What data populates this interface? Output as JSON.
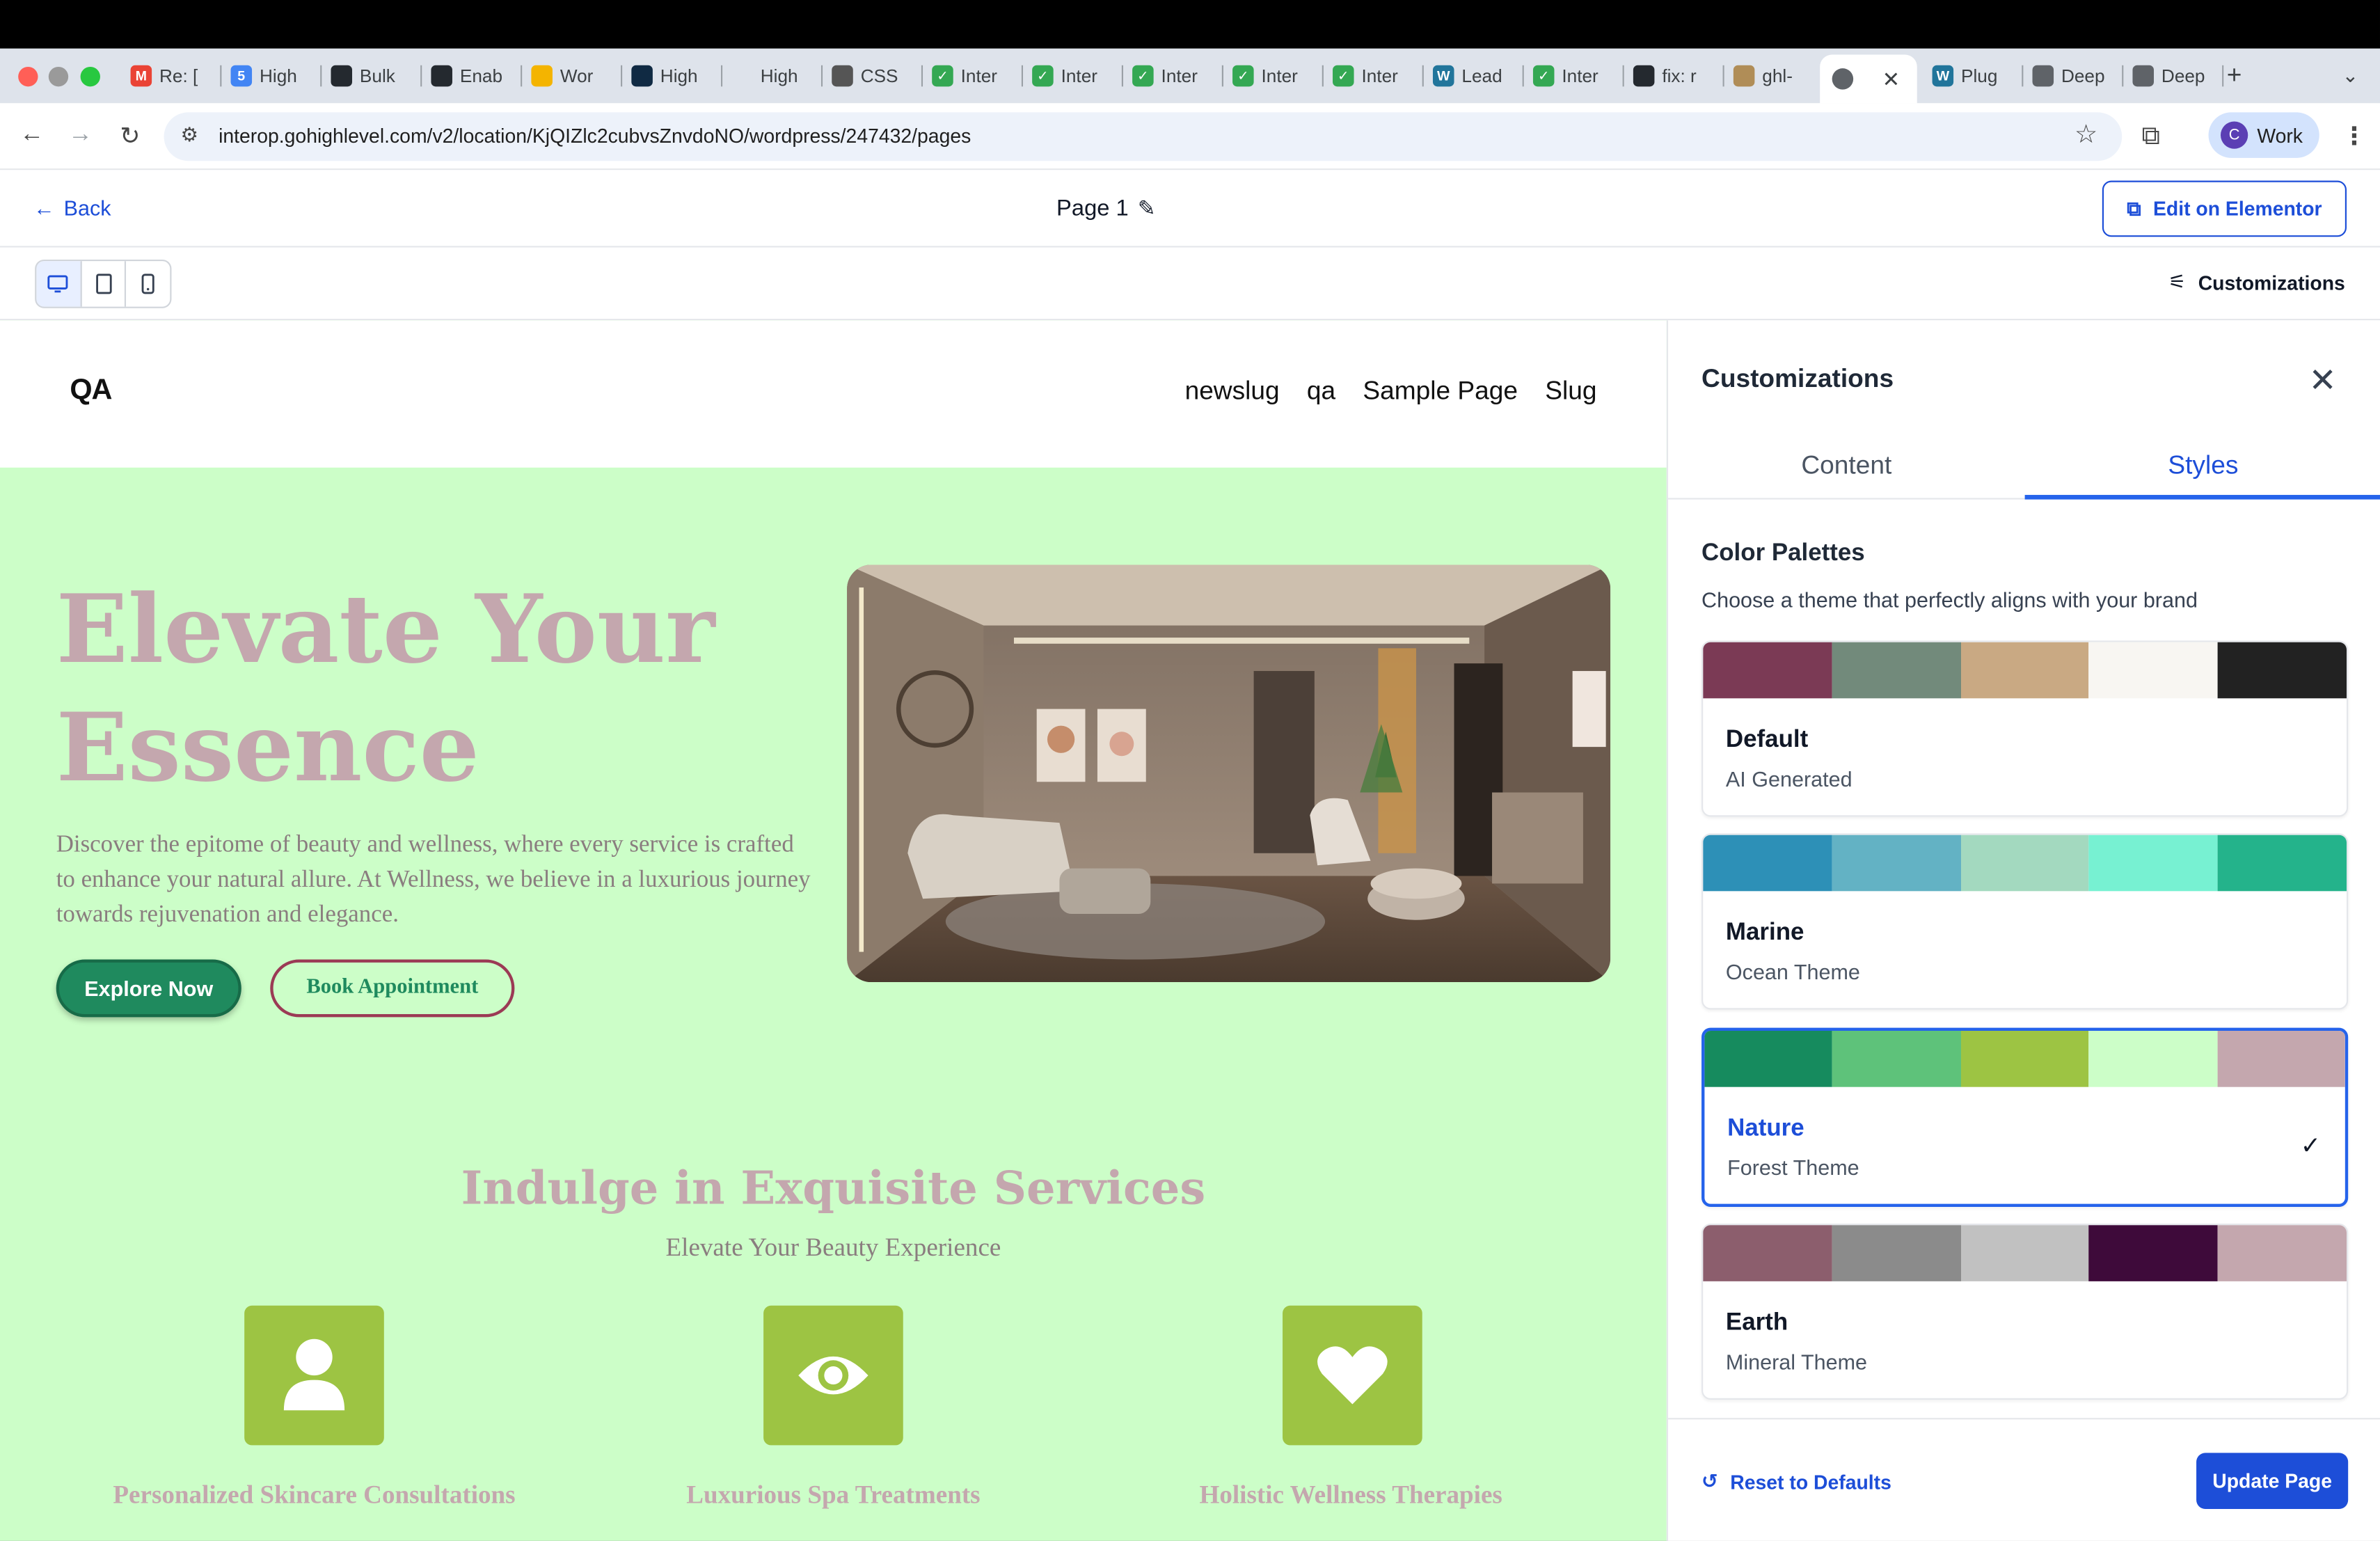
{
  "browser": {
    "tabs": [
      {
        "label": "Re: [",
        "fav": "M",
        "color": "#ea4335"
      },
      {
        "label": "High",
        "fav": "5",
        "color": "#4285f4"
      },
      {
        "label": "Bulk",
        "fav": "",
        "color": "#24292f"
      },
      {
        "label": "Enab",
        "fav": "",
        "color": "#24292f"
      },
      {
        "label": "Wor",
        "fav": "",
        "color": "#f4b400"
      },
      {
        "label": "High",
        "fav": "",
        "color": "#102a43"
      },
      {
        "label": "High",
        "fav": "",
        "color": "#dee3eb"
      },
      {
        "label": "CSS",
        "fav": "",
        "color": "#555555"
      },
      {
        "label": "Inter",
        "fav": "✓",
        "color": "#34a853"
      },
      {
        "label": "Inter",
        "fav": "✓",
        "color": "#34a853"
      },
      {
        "label": "Inter",
        "fav": "✓",
        "color": "#34a853"
      },
      {
        "label": "Inter",
        "fav": "✓",
        "color": "#34a853"
      },
      {
        "label": "Inter",
        "fav": "✓",
        "color": "#34a853"
      },
      {
        "label": "Lead",
        "fav": "W",
        "color": "#21759b"
      },
      {
        "label": "Inter",
        "fav": "✓",
        "color": "#34a853"
      },
      {
        "label": "fix: r",
        "fav": "",
        "color": "#24292f"
      },
      {
        "label": "ghl-",
        "fav": "",
        "color": "#b08d57"
      }
    ],
    "tabs_after": [
      {
        "label": "Plug",
        "fav": "W",
        "color": "#21759b"
      },
      {
        "label": "Deep",
        "fav": "",
        "color": "#5f6368"
      },
      {
        "label": "Deep",
        "fav": "",
        "color": "#5f6368"
      }
    ],
    "url": "interop.gohighlevel.com/v2/location/KjQIZlc2cubvsZnvdoNO/wordpress/247432/pages",
    "profile_initial": "C",
    "profile_label": "Work"
  },
  "header": {
    "back_label": "Back",
    "page_title": "Page 1",
    "edit_button": "Edit on Elementor",
    "customizations_link": "Customizations"
  },
  "site": {
    "logo": "QA",
    "nav": [
      "newslug",
      "qa",
      "Sample Page",
      "Slug"
    ],
    "hero_title_line1": "Elevate Your",
    "hero_title_line2": "Essence",
    "hero_body": "Discover the epitome of beauty and wellness, where every service is crafted to enhance your natural allure. At Wellness, we believe in a luxurious journey towards rejuvenation and elegance.",
    "btn_explore": "Explore Now",
    "btn_book": "Book Appointment",
    "services_title": "Indulge in Exquisite Services",
    "services_subtitle": "Elevate Your Beauty Experience",
    "services": [
      {
        "label": "Personalized Skincare Consultations",
        "icon": "person-icon"
      },
      {
        "label": "Luxurious Spa Treatments",
        "icon": "eye-icon"
      },
      {
        "label": "Holistic Wellness Therapies",
        "icon": "heart-icon"
      }
    ]
  },
  "panel": {
    "title": "Customizations",
    "tabs": [
      "Content",
      "Styles"
    ],
    "active_tab": "Styles",
    "section_title": "Color Palettes",
    "section_desc": "Choose a theme that perfectly aligns with your brand",
    "palettes": [
      {
        "name": "Default",
        "subtitle": "AI Generated",
        "colors": [
          "#7b3a55",
          "#728a7b",
          "#c9a983",
          "#f8f6f2",
          "#222222"
        ],
        "selected": false
      },
      {
        "name": "Marine",
        "subtitle": "Ocean Theme",
        "colors": [
          "#2d90b7",
          "#63b2c4",
          "#a3d9bf",
          "#77f1d2",
          "#24b38b"
        ],
        "selected": false
      },
      {
        "name": "Nature",
        "subtitle": "Forest Theme",
        "colors": [
          "#168b5e",
          "#5ec27a",
          "#9dc443",
          "#ccfec8",
          "#c4a7ae"
        ],
        "selected": true
      },
      {
        "name": "Earth",
        "subtitle": "Mineral Theme",
        "colors": [
          "#8c5e6d",
          "#8b8b8b",
          "#c1c1c1",
          "#3e0a3a",
          "#c4a7ae"
        ],
        "selected": false
      }
    ],
    "reset_label": "Reset to Defaults",
    "update_label": "Update Page"
  }
}
